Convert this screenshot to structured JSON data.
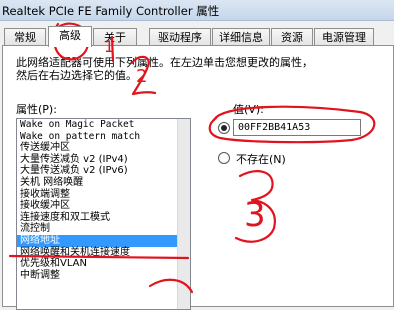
{
  "window": {
    "title": "Realtek PCIe FE Family Controller 属性"
  },
  "tabs": [
    {
      "label": "常规"
    },
    {
      "label": "高级"
    },
    {
      "label": "关于"
    },
    {
      "label": "驱动程序"
    },
    {
      "label": "详细信息"
    },
    {
      "label": "资源"
    },
    {
      "label": "电源管理"
    }
  ],
  "description": {
    "line1": "此网络适配器可使用下列属性。在左边单击您想更改的属性，",
    "line2": "然后在右边选择它的值。"
  },
  "property": {
    "label": "属性(P):",
    "items": [
      "Wake on Magic Packet",
      "Wake on pattern match",
      "传送缓冲区",
      "大量传送减负 v2 (IPv4)",
      "大量传送减负 v2 (IPv6)",
      "关机 网络唤醒",
      "接收端调整",
      "接收缓冲区",
      "连接速度和双工模式",
      "流控制",
      "网络地址",
      "网络唤醒和关机连接速度",
      "优先级和VLAN",
      "中断调整"
    ],
    "selected_index": 10
  },
  "value": {
    "label": "值(V):",
    "input_value": "00FF2BB41A53",
    "not_present_label": "不存在(N)",
    "selected_option": "value"
  },
  "annotations": {
    "marks": [
      "1",
      "2",
      "3"
    ],
    "color": "#e0141e"
  }
}
